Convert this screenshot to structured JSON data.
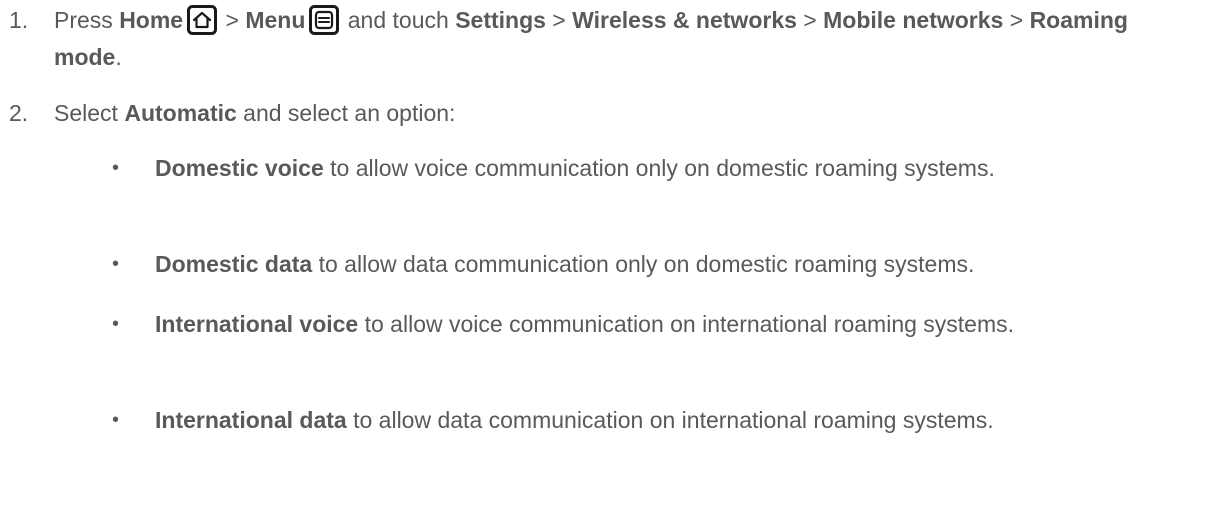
{
  "step1": {
    "number": "1.",
    "press": "Press ",
    "home": "Home",
    "sep1": " > ",
    "menu": "Menu",
    "touch": " and touch ",
    "settings": "Settings",
    "sep2": " > ",
    "wireless": "Wireless & networks",
    "sep3": " > ",
    "mobile": "Mobile networks",
    "sep4": " > ",
    "roaming": "Roaming mode",
    "end": "."
  },
  "step2": {
    "number": "2.",
    "select": "Select ",
    "automatic": "Automatic",
    "rest": " and select an option:"
  },
  "bullets": [
    {
      "marker": "•",
      "term": "Domestic voice",
      "desc": " to allow voice communication only on domestic roaming systems."
    },
    {
      "marker": "•",
      "term": "Domestic data",
      "desc": " to allow data communication only on domestic roaming systems."
    },
    {
      "marker": "•",
      "term": "International voice",
      "desc": " to allow voice communication on international roaming systems."
    },
    {
      "marker": "•",
      "term": "International data",
      "desc": " to allow data communication on international roaming systems."
    }
  ],
  "icons": {
    "home_icon": "home-key-icon",
    "menu_icon": "menu-key-icon",
    "icon_color": "#1a1a1a"
  }
}
